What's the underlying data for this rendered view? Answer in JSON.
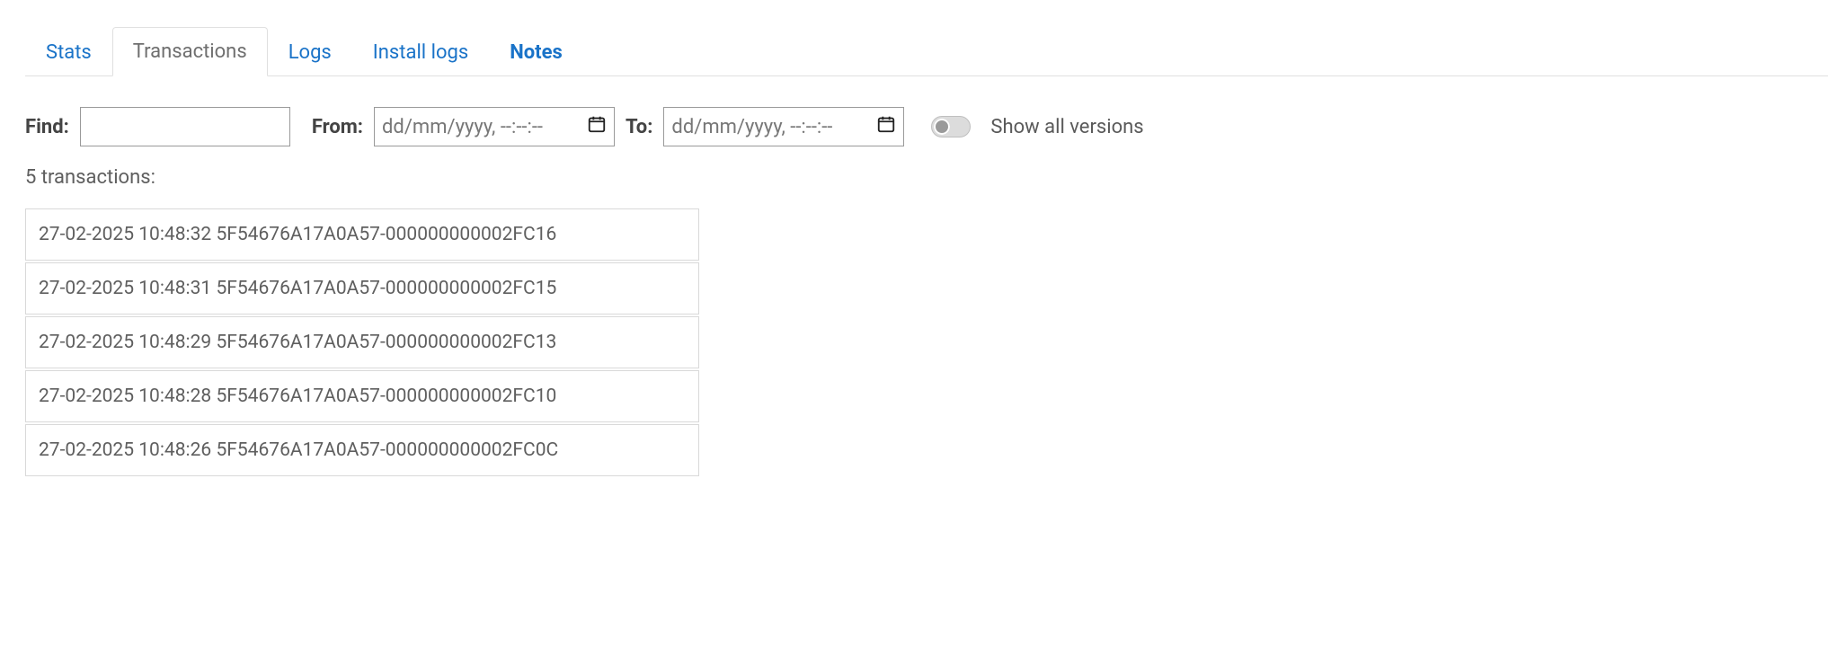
{
  "tabs": {
    "stats": "Stats",
    "transactions": "Transactions",
    "logs": "Logs",
    "install_logs": "Install logs",
    "notes": "Notes"
  },
  "filters": {
    "find_label": "Find:",
    "find_value": "",
    "from_label": "From:",
    "from_placeholder": "dd/mm/yyyy, --:--:--",
    "to_label": "To:",
    "to_placeholder": "dd/mm/yyyy, --:--:--",
    "show_all_versions_label": "Show all versions"
  },
  "summary": {
    "count_text": "5 transactions:"
  },
  "transactions": [
    {
      "datetime": "27-02-2025 10:48:32",
      "id": "5F54676A17A0A57-000000000002FC16"
    },
    {
      "datetime": "27-02-2025 10:48:31",
      "id": "5F54676A17A0A57-000000000002FC15"
    },
    {
      "datetime": "27-02-2025 10:48:29",
      "id": "5F54676A17A0A57-000000000002FC13"
    },
    {
      "datetime": "27-02-2025 10:48:28",
      "id": "5F54676A17A0A57-000000000002FC10"
    },
    {
      "datetime": "27-02-2025 10:48:26",
      "id": "5F54676A17A0A57-000000000002FC0C"
    }
  ]
}
